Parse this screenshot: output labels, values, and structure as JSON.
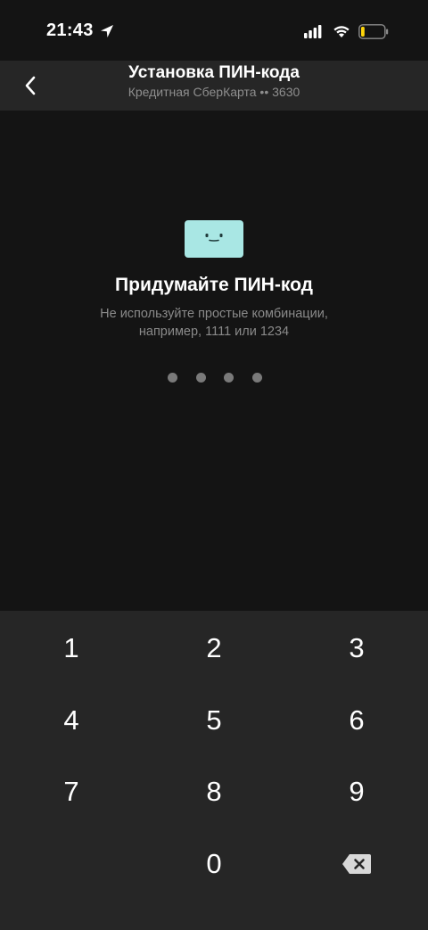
{
  "status_bar": {
    "time": "21:43",
    "icons": [
      "location-arrow-icon",
      "cellular-signal-icon",
      "wifi-icon",
      "battery-low-icon"
    ],
    "battery_level": 0.15,
    "battery_color": "#ffd60a"
  },
  "header": {
    "title": "Установка ПИН-кода",
    "subtitle": "Кредитная СберКарта •• 3630",
    "back_icon": "chevron-left-icon"
  },
  "main": {
    "icon": "card-face-icon",
    "icon_color": "#a9e7e4",
    "title": "Придумайте ПИН-код",
    "hint": "Не используйте простые комбинации, например, 1111 или 1234",
    "pin_length": 4,
    "digits_entered": 0
  },
  "keypad": {
    "keys": [
      "1",
      "2",
      "3",
      "4",
      "5",
      "6",
      "7",
      "8",
      "9",
      "0"
    ],
    "delete_icon": "backspace-icon"
  },
  "colors": {
    "background": "#141414",
    "surface": "#262626",
    "text_primary": "#ffffff",
    "text_secondary": "#8e8e8e",
    "dot": "#7a7a7a"
  }
}
